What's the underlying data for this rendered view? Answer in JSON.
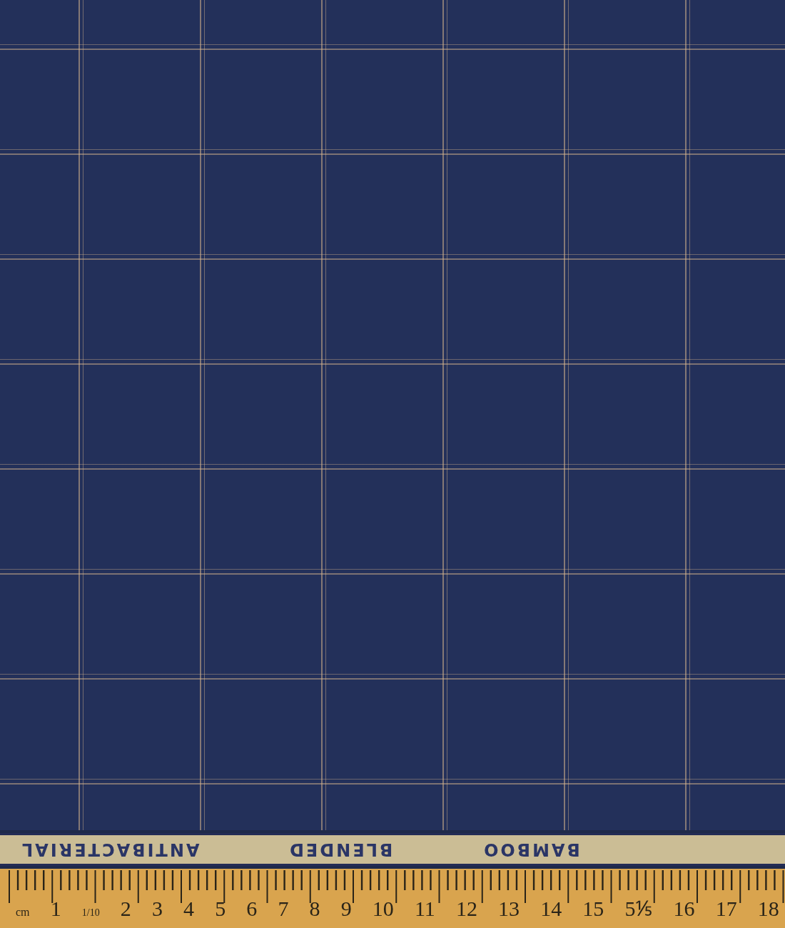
{
  "selvedge": {
    "words": [
      "ANTIBACTERIAL",
      "BLENDED",
      "BAMBOO"
    ]
  },
  "ruler": {
    "labels": [
      {
        "text": "cm",
        "kind": "unit"
      },
      {
        "text": "1",
        "kind": "number"
      },
      {
        "text": "1/10",
        "kind": "note"
      },
      {
        "text": "2",
        "kind": "number"
      },
      {
        "text": "3",
        "kind": "number"
      },
      {
        "text": "4",
        "kind": "number"
      },
      {
        "text": "5",
        "kind": "number"
      },
      {
        "text": "6",
        "kind": "number"
      },
      {
        "text": "7",
        "kind": "number"
      },
      {
        "text": "8",
        "kind": "number"
      },
      {
        "text": "9",
        "kind": "number"
      },
      {
        "text": "10",
        "kind": "number"
      },
      {
        "text": "11",
        "kind": "number"
      },
      {
        "text": "12",
        "kind": "number"
      },
      {
        "text": "13",
        "kind": "number"
      },
      {
        "text": "14",
        "kind": "number"
      },
      {
        "text": "15",
        "kind": "number"
      },
      {
        "text": "5⅕",
        "kind": "number"
      },
      {
        "text": "16",
        "kind": "number"
      },
      {
        "text": "17",
        "kind": "number"
      },
      {
        "text": "18",
        "kind": "number"
      }
    ]
  }
}
